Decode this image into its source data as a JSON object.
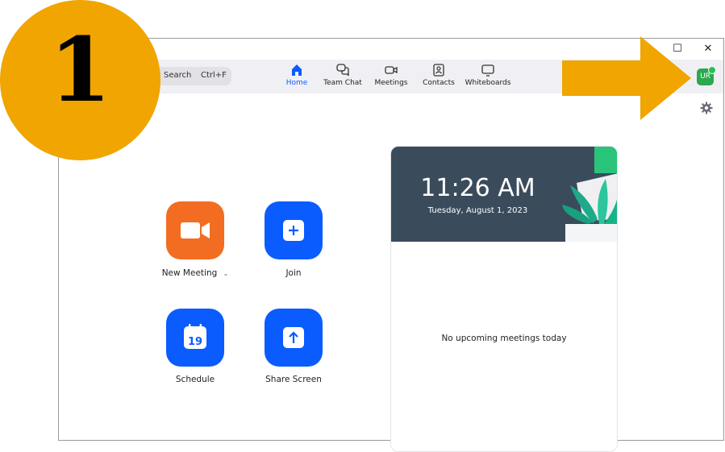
{
  "step": {
    "number": "1"
  },
  "window_controls": {
    "maximize": "☐",
    "close": "✕"
  },
  "search": {
    "label": "Search",
    "shortcut": "Ctrl+F"
  },
  "nav": [
    {
      "label": "Home",
      "icon": "home-icon",
      "active": true
    },
    {
      "label": "Team Chat",
      "icon": "chat-icon"
    },
    {
      "label": "Meetings",
      "icon": "video-icon"
    },
    {
      "label": "Contacts",
      "icon": "contacts-icon"
    },
    {
      "label": "Whiteboards",
      "icon": "whiteboard-icon"
    }
  ],
  "profile": {
    "initials": "UR",
    "status_color": "#29c053"
  },
  "actions": {
    "new_meeting": "New Meeting",
    "join": "Join",
    "schedule": "Schedule",
    "schedule_day": "19",
    "share_screen": "Share Screen"
  },
  "card": {
    "time": "11:26 AM",
    "date": "Tuesday, August 1, 2023",
    "empty_message": "No upcoming meetings today"
  },
  "colors": {
    "accent": "#0b5cff",
    "new_meeting": "#f26d21",
    "badge": "#f0a500"
  }
}
